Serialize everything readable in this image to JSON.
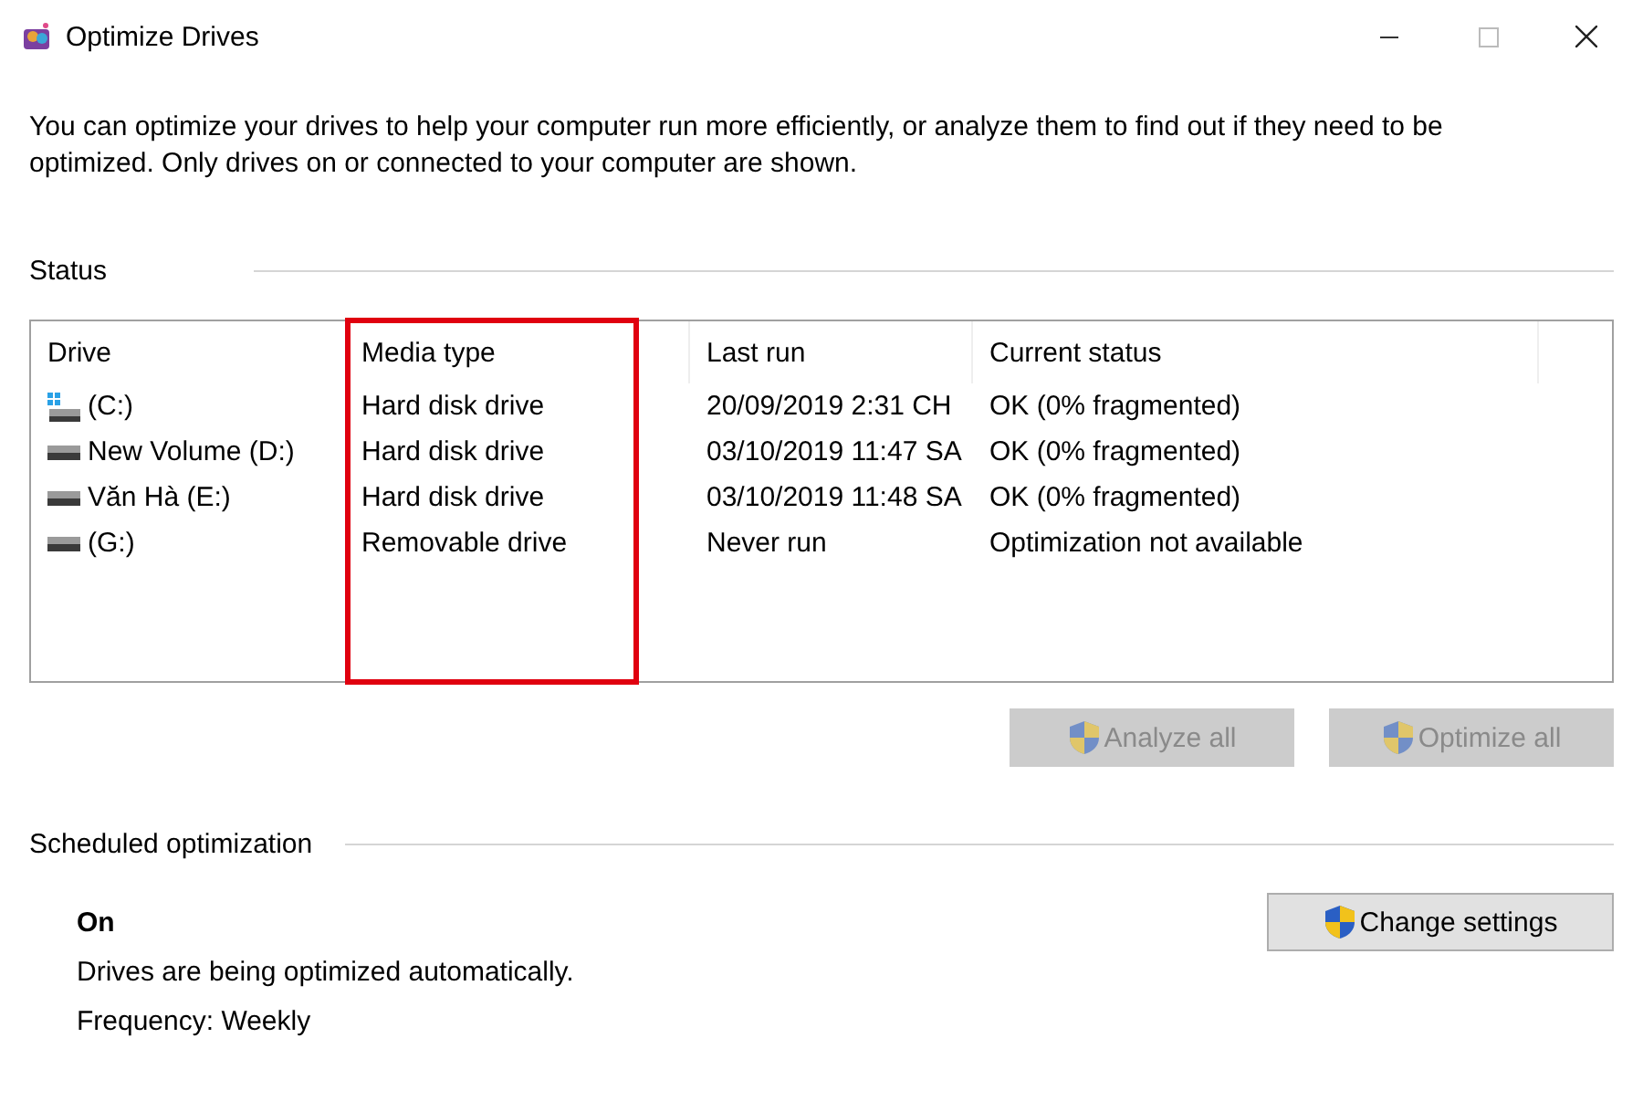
{
  "window": {
    "title": "Optimize Drives"
  },
  "description": "You can optimize your drives to help your computer run more efficiently, or analyze them to find out if they need to be optimized. Only drives on or connected to your computer are shown.",
  "status": {
    "heading": "Status",
    "columns": [
      {
        "label": "Drive",
        "highlighted": false
      },
      {
        "label": "Media type",
        "highlighted": true
      },
      {
        "label": "Last run",
        "highlighted": false
      },
      {
        "label": "Current status",
        "highlighted": false
      }
    ],
    "rows": [
      {
        "kind": "system",
        "drive": "(C:)",
        "media_type": "Hard disk drive",
        "last_run": "20/09/2019 2:31 CH",
        "current_status": "OK (0% fragmented)"
      },
      {
        "kind": "disk",
        "drive": "New Volume (D:)",
        "media_type": "Hard disk drive",
        "last_run": "03/10/2019 11:47 SA",
        "current_status": "OK (0% fragmented)"
      },
      {
        "kind": "disk",
        "drive": "Văn Hà (E:)",
        "media_type": "Hard disk drive",
        "last_run": "03/10/2019 11:48 SA",
        "current_status": "OK (0% fragmented)"
      },
      {
        "kind": "disk",
        "drive": "(G:)",
        "media_type": "Removable drive",
        "last_run": "Never run",
        "current_status": "Optimization not available"
      }
    ],
    "buttons": [
      {
        "label": "Analyze all",
        "disabled": true
      },
      {
        "label": "Optimize all",
        "disabled": true
      }
    ]
  },
  "scheduled": {
    "heading": "Scheduled optimization",
    "state": "On",
    "message": "Drives are being optimized automatically.",
    "frequency": "Frequency: Weekly",
    "button": {
      "label": "Change settings",
      "disabled": false
    }
  }
}
